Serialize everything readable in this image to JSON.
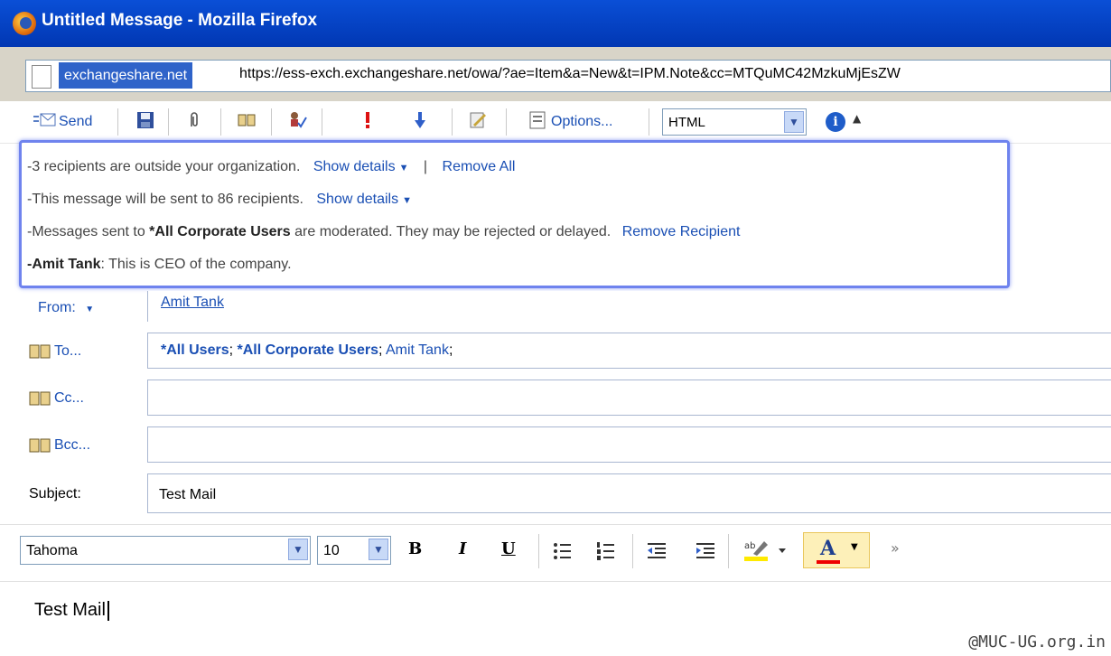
{
  "window": {
    "title": "Untitled Message - Mozilla Firefox"
  },
  "address": {
    "site_badge": "exchangeshare.net",
    "url": "https://ess-exch.exchangeshare.net/owa/?ae=Item&a=New&t=IPM.Note&cc=MTQuMC42MzkuMjEsZW"
  },
  "toolbar": {
    "send_label": "Send",
    "options_label": "Options...",
    "format_value": "HTML",
    "icons": [
      "save-icon",
      "attach-icon",
      "address-book-icon",
      "check-names-icon",
      "high-importance-icon",
      "low-importance-icon",
      "signature-icon",
      "options-icon",
      "info-icon"
    ]
  },
  "infobar": {
    "line1_text": "-3 recipients are outside your organization.",
    "line1_link": "Show details",
    "line1_sep": "|",
    "line1_link2": "Remove All",
    "line2_text": "-This message will be sent to 86 recipients.",
    "line2_link": "Show details",
    "line3_prefix": "-Messages sent to ",
    "line3_bold": "*All Corporate Users",
    "line3_suffix": " are moderated. They may be rejected or delayed.",
    "line3_link": "Remove Recipient",
    "line4_bold": "-Amit Tank",
    "line4_text": ": This is CEO of the company."
  },
  "form": {
    "from_label": "From:",
    "from_value": "Amit Tank",
    "to_label": "To...",
    "to_recipients": [
      "*All Users",
      "*All Corporate Users",
      "Amit Tank"
    ],
    "cc_label": "Cc...",
    "bcc_label": "Bcc...",
    "subject_label": "Subject:",
    "subject_value": "Test Mail"
  },
  "editor": {
    "font_family": "Tahoma",
    "font_size": "10",
    "bold": "B",
    "italic": "I",
    "underline": "U",
    "font_color_letter": "A",
    "body_text": "Test Mail"
  },
  "watermark": "@MUC-UG.org.in",
  "colors": {
    "titlebar": "#0a4fd6",
    "link": "#1a4fb4",
    "infobar_border": "#6f83ee"
  }
}
